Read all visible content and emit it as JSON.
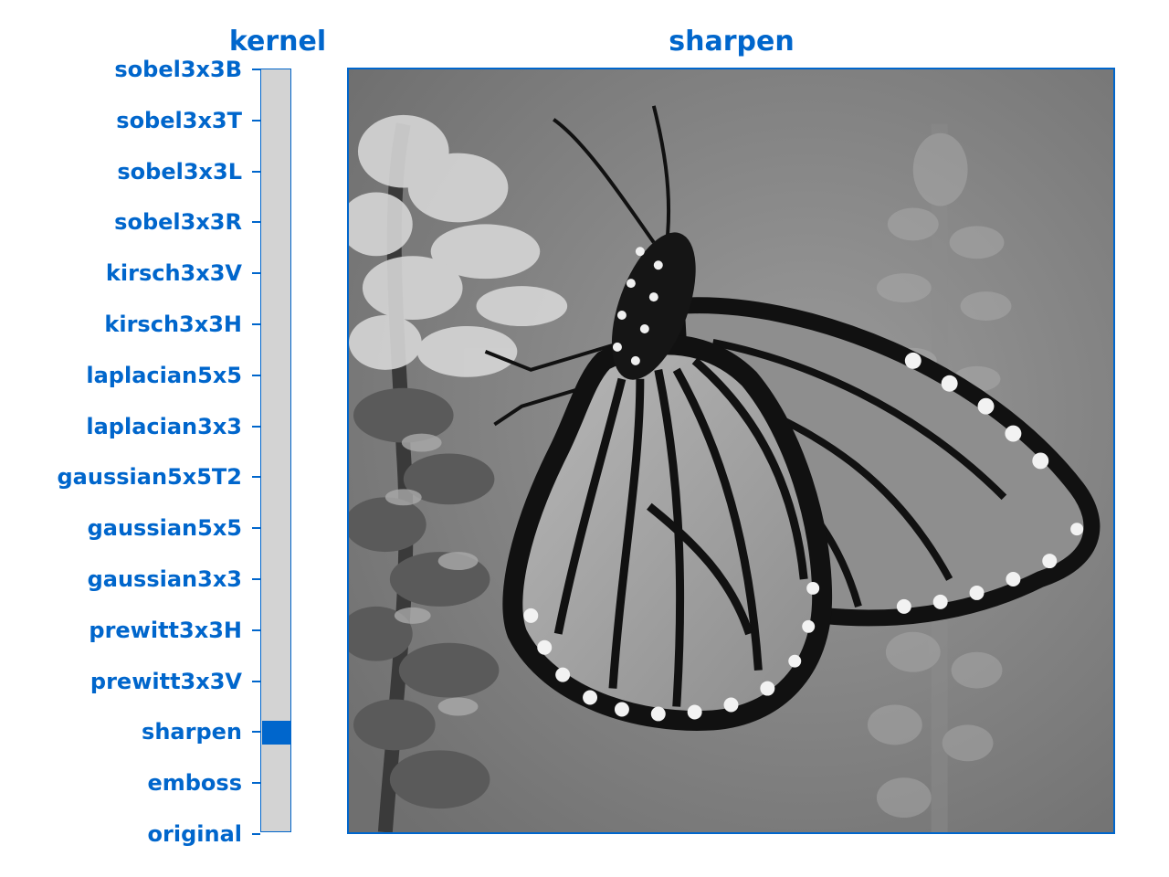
{
  "control": {
    "title": "kernel",
    "selected_index": 13,
    "options": [
      "sobel3x3B",
      "sobel3x3T",
      "sobel3x3L",
      "sobel3x3R",
      "kirsch3x3V",
      "kirsch3x3H",
      "laplacian5x5",
      "laplacian3x3",
      "gaussian5x5T2",
      "gaussian5x5",
      "gaussian3x3",
      "prewitt3x3H",
      "prewitt3x3V",
      "sharpen",
      "emboss",
      "original"
    ]
  },
  "image_panel": {
    "title": "sharpen",
    "content": "grayscale-butterfly-photo"
  },
  "colors": {
    "accent": "#0066cc",
    "track": "#d3d3d3"
  }
}
